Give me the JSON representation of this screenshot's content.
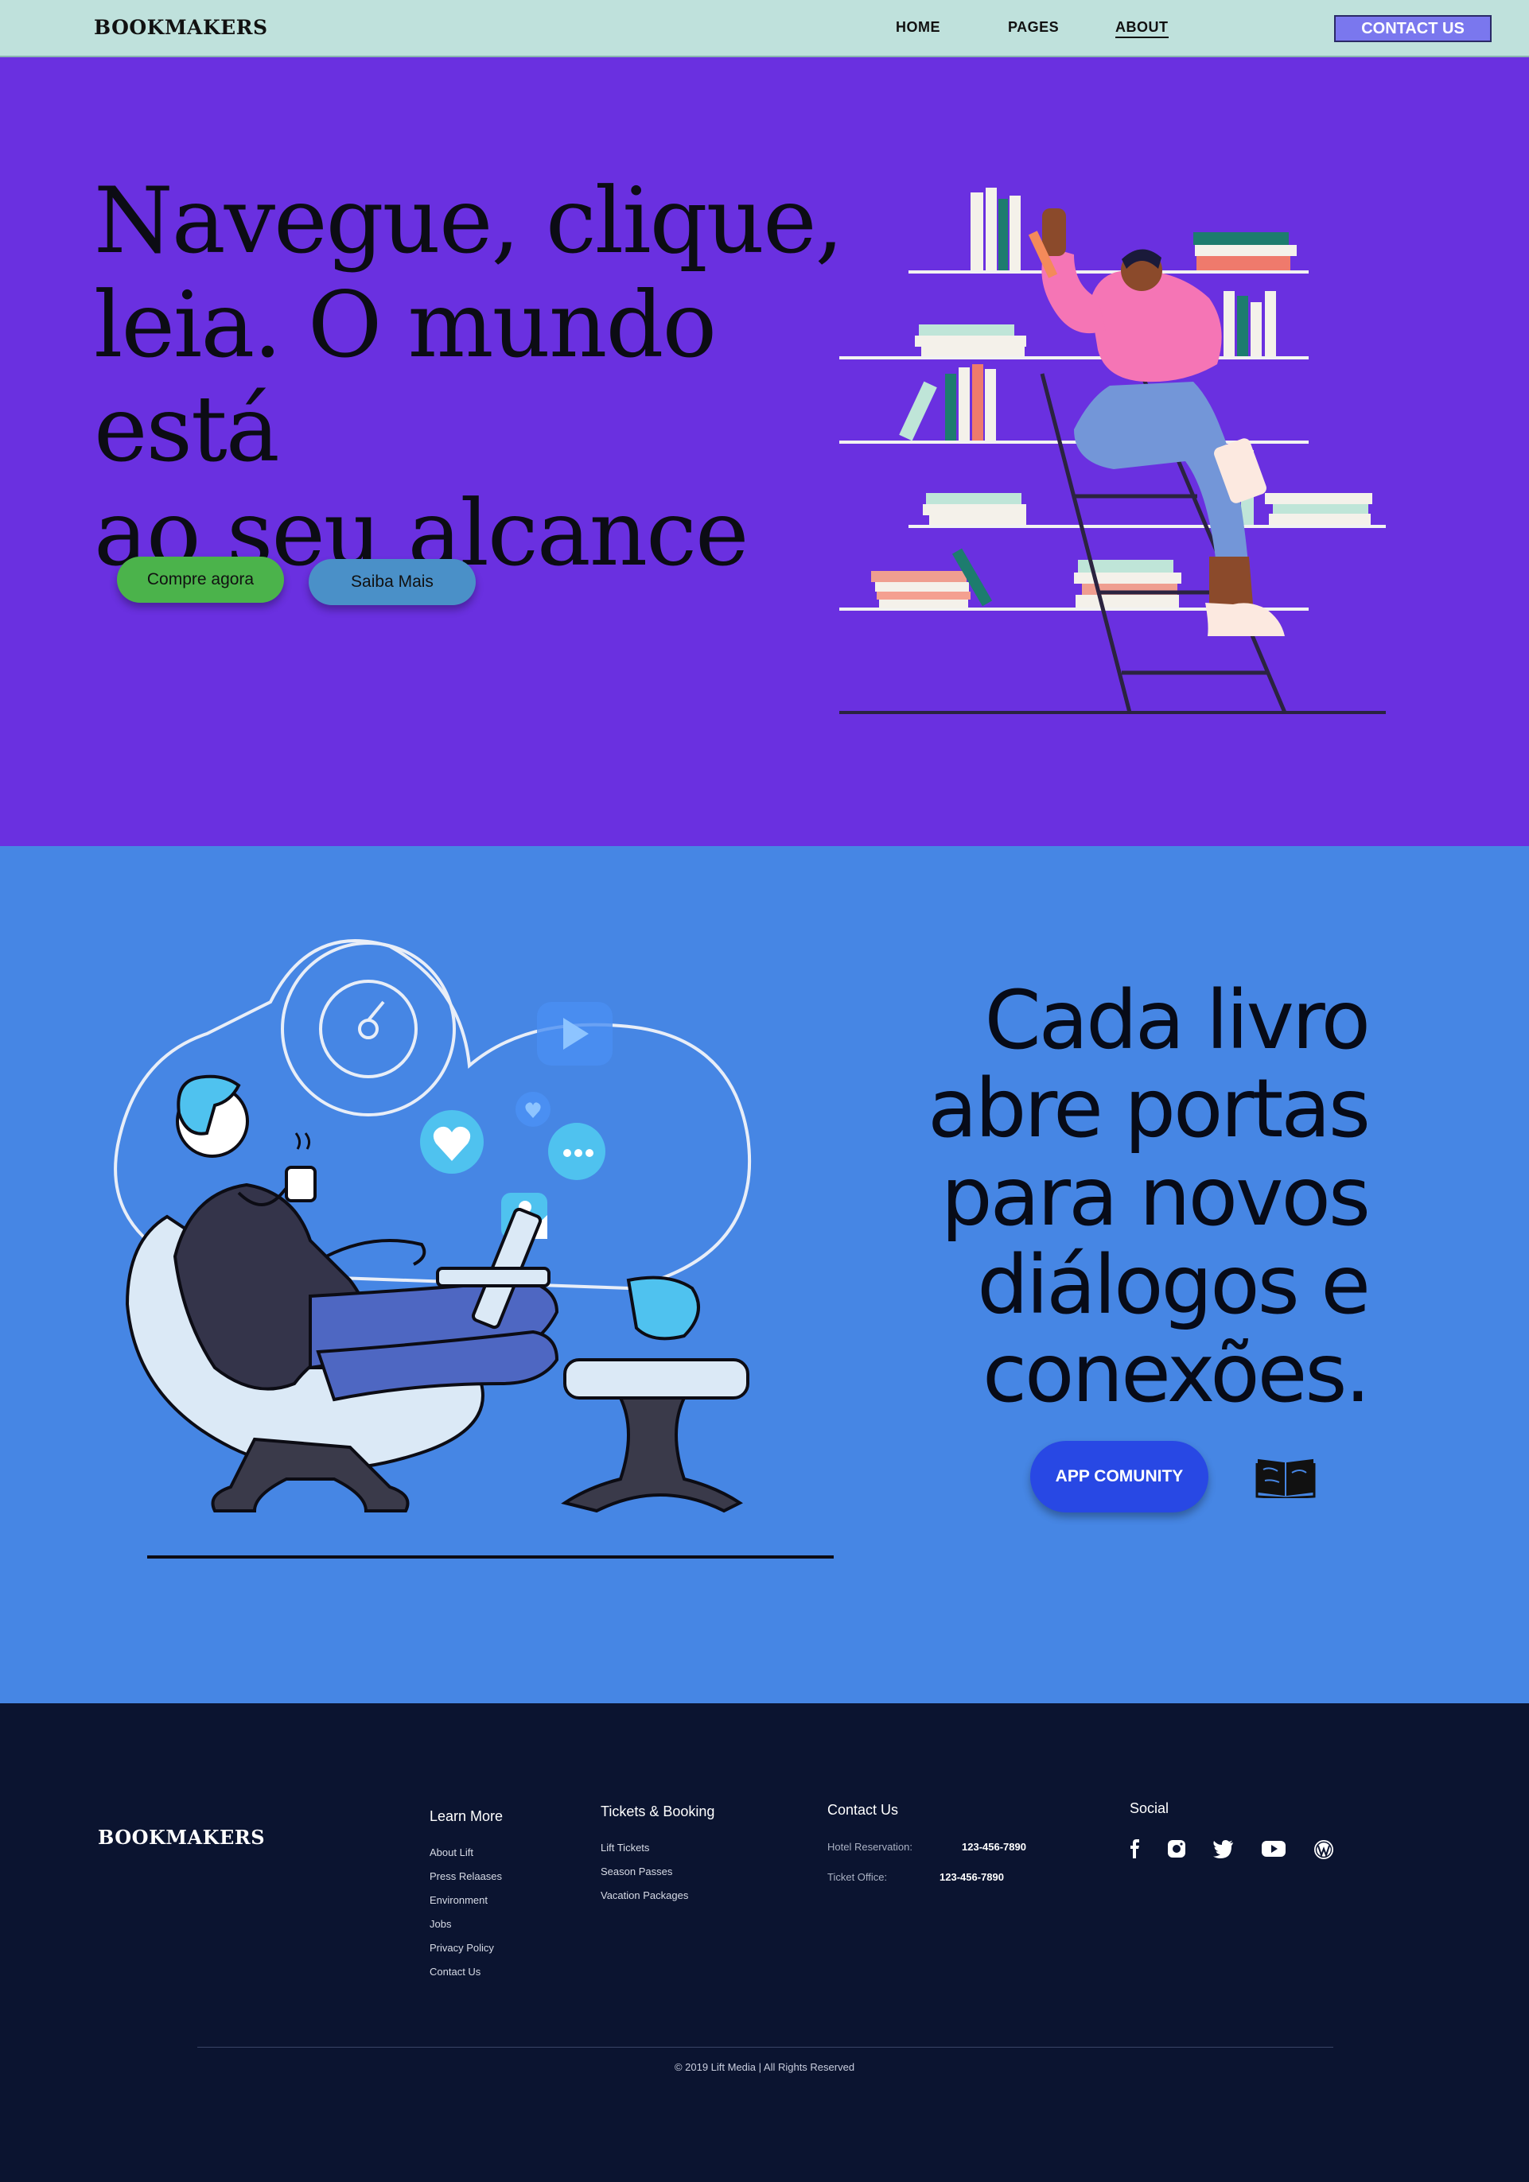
{
  "brand": "BOOKMAKERS",
  "nav": {
    "links": [
      "HOME",
      "PAGES",
      "ABOUT"
    ],
    "contact": "CONTACT US"
  },
  "hero": {
    "title_lines": [
      "Navegue, clique,",
      "leia. O mundo está",
      "ao seu alcance"
    ],
    "buy_button": "Compre agora",
    "more_button": "Saiba Mais",
    "bg_color": "#6a30e0"
  },
  "section2": {
    "title_lines": [
      "Cada livro",
      "abre portas",
      "para novos",
      "diálogos e",
      "conexões."
    ],
    "app_button": "APP COMUNITY",
    "bg_color": "#4686e4"
  },
  "footer": {
    "brand": "BOOKMAKERS",
    "learn_more": {
      "title": "Learn More",
      "items": [
        "About Lift",
        "Press Relaases",
        "Environment",
        "Jobs",
        "Privacy Policy",
        "Contact Us"
      ]
    },
    "tickets": {
      "title": "Tickets & Booking",
      "items": [
        "Lift Tickets",
        "Season Passes",
        "Vacation Packages"
      ]
    },
    "contact": {
      "title": "Contact Us",
      "hotel_label": "Hotel Reservation:",
      "hotel_value": "123-456-7890",
      "office_label": "Ticket Office:",
      "office_value": "123-456-7890"
    },
    "social": {
      "title": "Social",
      "icons": [
        "facebook-icon",
        "instagram-icon",
        "twitter-icon",
        "youtube-icon",
        "wordpress-icon"
      ]
    },
    "copyright": "© 2019 Lift Media | All Rights Reserved"
  }
}
